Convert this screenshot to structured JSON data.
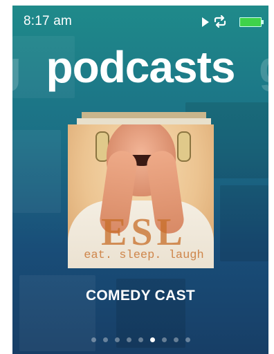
{
  "status_bar": {
    "time": "8:17 am",
    "icons": [
      "play-icon",
      "repeat-icon",
      "battery-icon"
    ],
    "battery_level": 1.0
  },
  "header": {
    "title": "podcasts",
    "ghost_prev": "g",
    "ghost_next": "g"
  },
  "current_podcast": {
    "name": "COMEDY CAST",
    "cover_logo": "ESL",
    "cover_tagline": "eat. sleep. laugh"
  },
  "pagination": {
    "total": 9,
    "active_index": 5
  },
  "colors": {
    "background_top": "#1f8a8a",
    "background_bottom": "#173e66",
    "battery": "#3fd24a",
    "text": "#ffffff"
  }
}
